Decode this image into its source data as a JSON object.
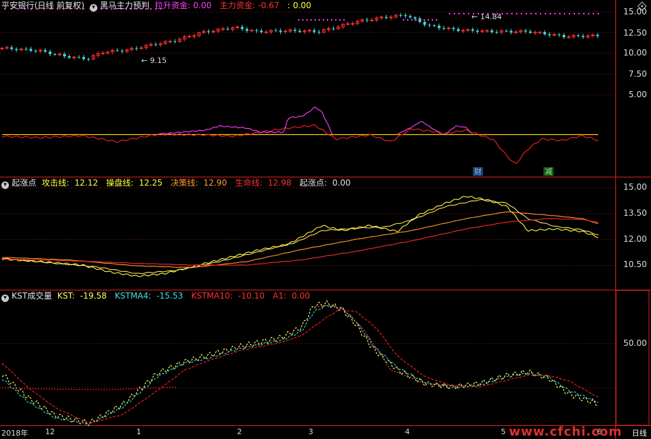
{
  "pane1": {
    "stock": "平安银行(日线 前复权)",
    "indicator": "黑马主力预判",
    "items": [
      {
        "label": "拉升资金:",
        "value": "0.00",
        "color": "#ff40ff"
      },
      {
        "label": "主力资金:",
        "value": "-0.67",
        "color": "#ff3030"
      },
      {
        "label": ":",
        "value": "0.00",
        "color": "#ffff40"
      }
    ],
    "axis": [
      "15.00",
      "12.50",
      "10.00",
      "7.50",
      "5.00"
    ],
    "low_mark": "9.15",
    "high_mark": "14.84",
    "tag_cai": "财",
    "tag_jian": "减"
  },
  "pane2": {
    "indicator": "起涨点",
    "items": [
      {
        "label": "攻击线:",
        "value": "12.12",
        "color": "#ffff40"
      },
      {
        "label": "操盘线:",
        "value": "12.25",
        "color": "#ffff40"
      },
      {
        "label": "决策线:",
        "value": "12.90",
        "color": "#ff9a30"
      },
      {
        "label": "生命线:",
        "value": "12.98",
        "color": "#ff3030"
      },
      {
        "label": "起涨点:",
        "value": "0.00",
        "color": "#e0e0e0"
      }
    ],
    "axis": [
      "15.00",
      "13.50",
      "12.00",
      "10.50"
    ]
  },
  "pane3": {
    "indicator": "KST成交量",
    "items": [
      {
        "label": "KST:",
        "value": "-19.58",
        "color": "#ffff60"
      },
      {
        "label": "KSTMA4:",
        "value": "-15.53",
        "color": "#40e0e0"
      },
      {
        "label": "KSTMA10:",
        "value": "-10.10",
        "color": "#ff3030"
      },
      {
        "label": "A1:",
        "value": "0.00",
        "color": "#ff3030"
      }
    ],
    "axis": [
      "50.00"
    ]
  },
  "time_axis": [
    "2018年",
    "12",
    "1",
    "2",
    "3",
    "4",
    "5",
    "6"
  ],
  "period": "日线",
  "watermark": "www.cfchi.com"
}
